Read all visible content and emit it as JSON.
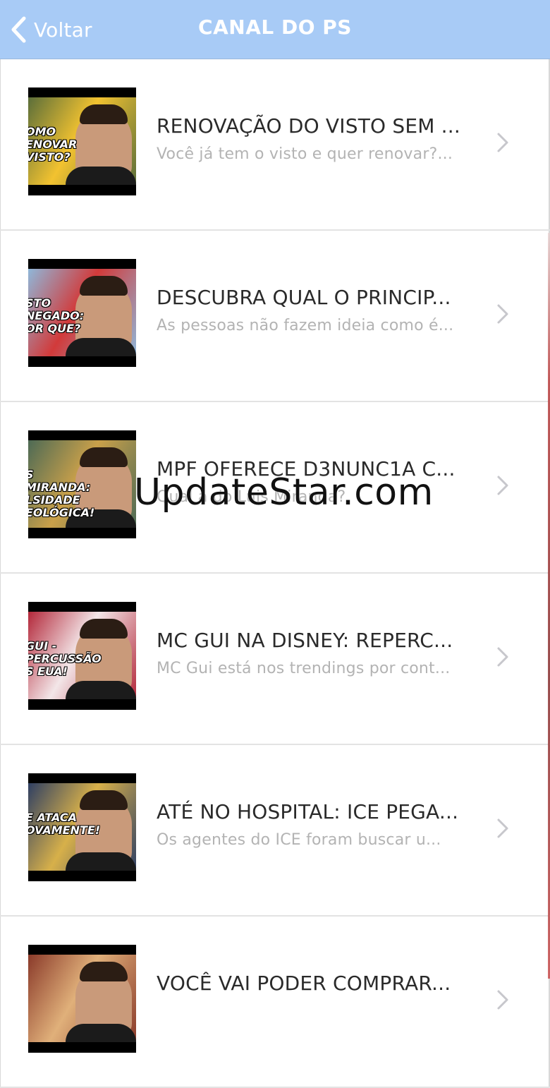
{
  "navbar": {
    "back_label": "Voltar",
    "title": "CANAL DO PS",
    "background_color": "#a8cbf6"
  },
  "videos": [
    {
      "title": "RENOVAÇÃO DO VISTO SEM ENTREVISTA",
      "display_title": "RENOVAÇÃO DO VISTO SEM ...",
      "subtitle": "Você já tem o visto e quer renovar?...",
      "thumb_caption": "OMO\nENOVAR\nVISTO?",
      "thumb_bg": "#5b6e3a",
      "thumb_accent": "#f2c230"
    },
    {
      "title": "DESCUBRA QUAL O PRINCIPAL",
      "display_title": "DESCUBRA QUAL O PRINCIP...",
      "subtitle": "As pessoas não fazem ideia como é...",
      "thumb_caption": "STO NEGADO:\nOR QUE?",
      "thumb_bg": "#8fb7d9",
      "thumb_accent": "#d23a3a"
    },
    {
      "title": "MPF OFERECE D3NUNC1A C",
      "display_title": "MPF OFERECE D3NUNC1A C...",
      "subtitle": "Qual a do Luis Miranda?",
      "thumb_caption": "S MIRANDA:\nLSIDADE\nEOLÓGICA!",
      "thumb_bg": "#4d6a55",
      "thumb_accent": "#c9a04a"
    },
    {
      "title": "MC GUI NA DISNEY: REPERCUSSÃO",
      "display_title": "MC GUI NA DISNEY: REPERC...",
      "subtitle": "MC Gui está nos trendings por cont...",
      "thumb_caption": "GUI -\nPERCUSSÃO\nS EUA!",
      "thumb_bg": "#b3283a",
      "thumb_accent": "#f3e6e8"
    },
    {
      "title": "ATÉ NO HOSPITAL: ICE PEGA",
      "display_title": "ATÉ NO HOSPITAL: ICE PEGA...",
      "subtitle": "Os agentes do ICE foram buscar u...",
      "thumb_caption": "E ATACA\nOVAMENTE!",
      "thumb_bg": "#2f3f63",
      "thumb_accent": "#d7b04a"
    },
    {
      "title": "VOCÊ VAI PODER COMPRAR",
      "display_title": "VOCÊ VAI PODER COMPRAR...",
      "subtitle": "",
      "thumb_caption": "",
      "thumb_bg": "#8a3a2a",
      "thumb_accent": "#e0b07a"
    }
  ],
  "watermark": "UpdateStar.com",
  "icons": {
    "back": "chevron-left-icon",
    "row_disclosure": "chevron-right-icon"
  },
  "colors": {
    "title_text": "#2a2a2a",
    "subtitle_text": "#b3b3b3",
    "separator": "#e3e3e3",
    "chevron": "#c7c7cc"
  }
}
